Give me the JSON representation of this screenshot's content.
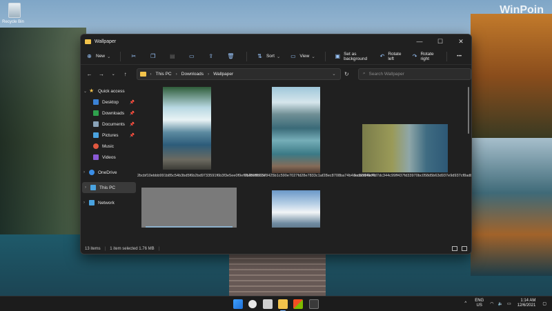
{
  "desktop": {
    "watermark": "WinPoin",
    "recycle_bin_label": "Recycle Bin"
  },
  "window": {
    "title": "Wallpaper",
    "controls": {
      "minimize": "—",
      "maximize": "☐",
      "close": "✕"
    }
  },
  "toolbar": {
    "new_label": "New",
    "sort_label": "Sort",
    "view_label": "View",
    "set_bg_label": "Set as background",
    "rotate_left_label": "Rotate left",
    "rotate_right_label": "Rotate right",
    "more_label": "•••"
  },
  "address": {
    "segments": [
      "This PC",
      "Downloads",
      "Wallpaper"
    ],
    "search_placeholder": "Search Wallpaper"
  },
  "sidebar": {
    "quick_access": "Quick access",
    "items": [
      {
        "label": "Desktop",
        "color": "#3b82d6"
      },
      {
        "label": "Downloads",
        "color": "#2fa14d"
      },
      {
        "label": "Documents",
        "color": "#8aa3b8"
      },
      {
        "label": "Pictures",
        "color": "#4aa3e0"
      },
      {
        "label": "Music",
        "color": "#e0573f"
      },
      {
        "label": "Videos",
        "color": "#8a5ad6"
      }
    ],
    "onedrive": "OneDrive",
    "this_pc": "This PC",
    "network": "Network"
  },
  "files": [
    {
      "caption": "2bcbf10ebbb991b85c54b3bd5f6b2bd9733591f6b3f3e5ee0f9ef014beffb53e"
    },
    {
      "caption": "7b289566578425b1c590e7027fd28e7833c1af28ec8708ba74b4deca0f04e73"
    },
    {
      "caption": "7cd55949d4d7dc344c99ff437fd33970bc058d5b63d937e9d937cf8adb99bf9c1"
    }
  ],
  "status": {
    "items_count": "13 items",
    "selection": "1 item selected  1.76 MB"
  },
  "tray": {
    "lang_top": "ENG",
    "lang_bottom": "US",
    "time": "1:14 AM",
    "date": "12/6/2021"
  }
}
